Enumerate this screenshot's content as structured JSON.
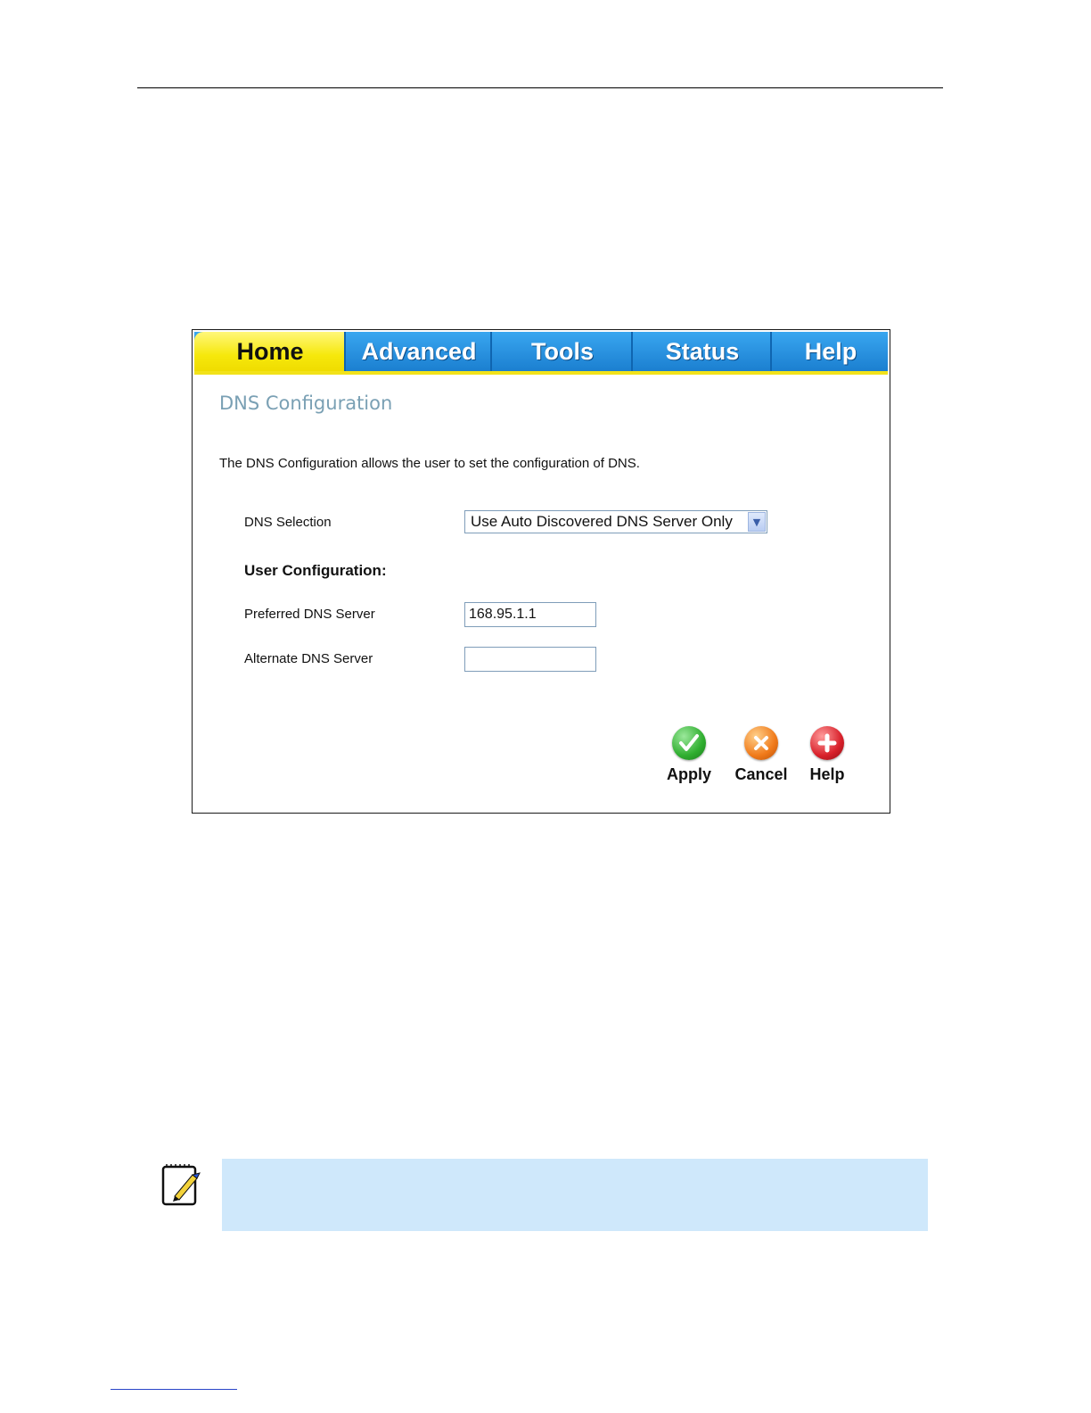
{
  "tabs": [
    {
      "label": "Home",
      "active": true
    },
    {
      "label": "Advanced",
      "active": false
    },
    {
      "label": "Tools",
      "active": false
    },
    {
      "label": "Status",
      "active": false
    },
    {
      "label": "Help",
      "active": false
    }
  ],
  "page": {
    "title": "DNS Configuration",
    "description": "The DNS Configuration allows the user to set the configuration of DNS."
  },
  "form": {
    "dns_selection_label": "DNS Selection",
    "dns_selection_value": "Use Auto Discovered DNS Server Only",
    "user_config_heading": "User Configuration:",
    "preferred_label": "Preferred DNS Server",
    "preferred_value": "168.95.1.1",
    "alternate_label": "Alternate DNS Server",
    "alternate_value": ""
  },
  "actions": {
    "apply_label": "Apply",
    "cancel_label": "Cancel",
    "help_label": "Help"
  },
  "colors": {
    "tab_blue": "#1b7fd0",
    "tab_active_yellow": "#f6e80c",
    "title_color": "#7aa0b4",
    "apply_green": "#2fae2f",
    "cancel_orange": "#f07a1a",
    "help_red": "#d8202a",
    "note_background": "#cfe8fb"
  }
}
